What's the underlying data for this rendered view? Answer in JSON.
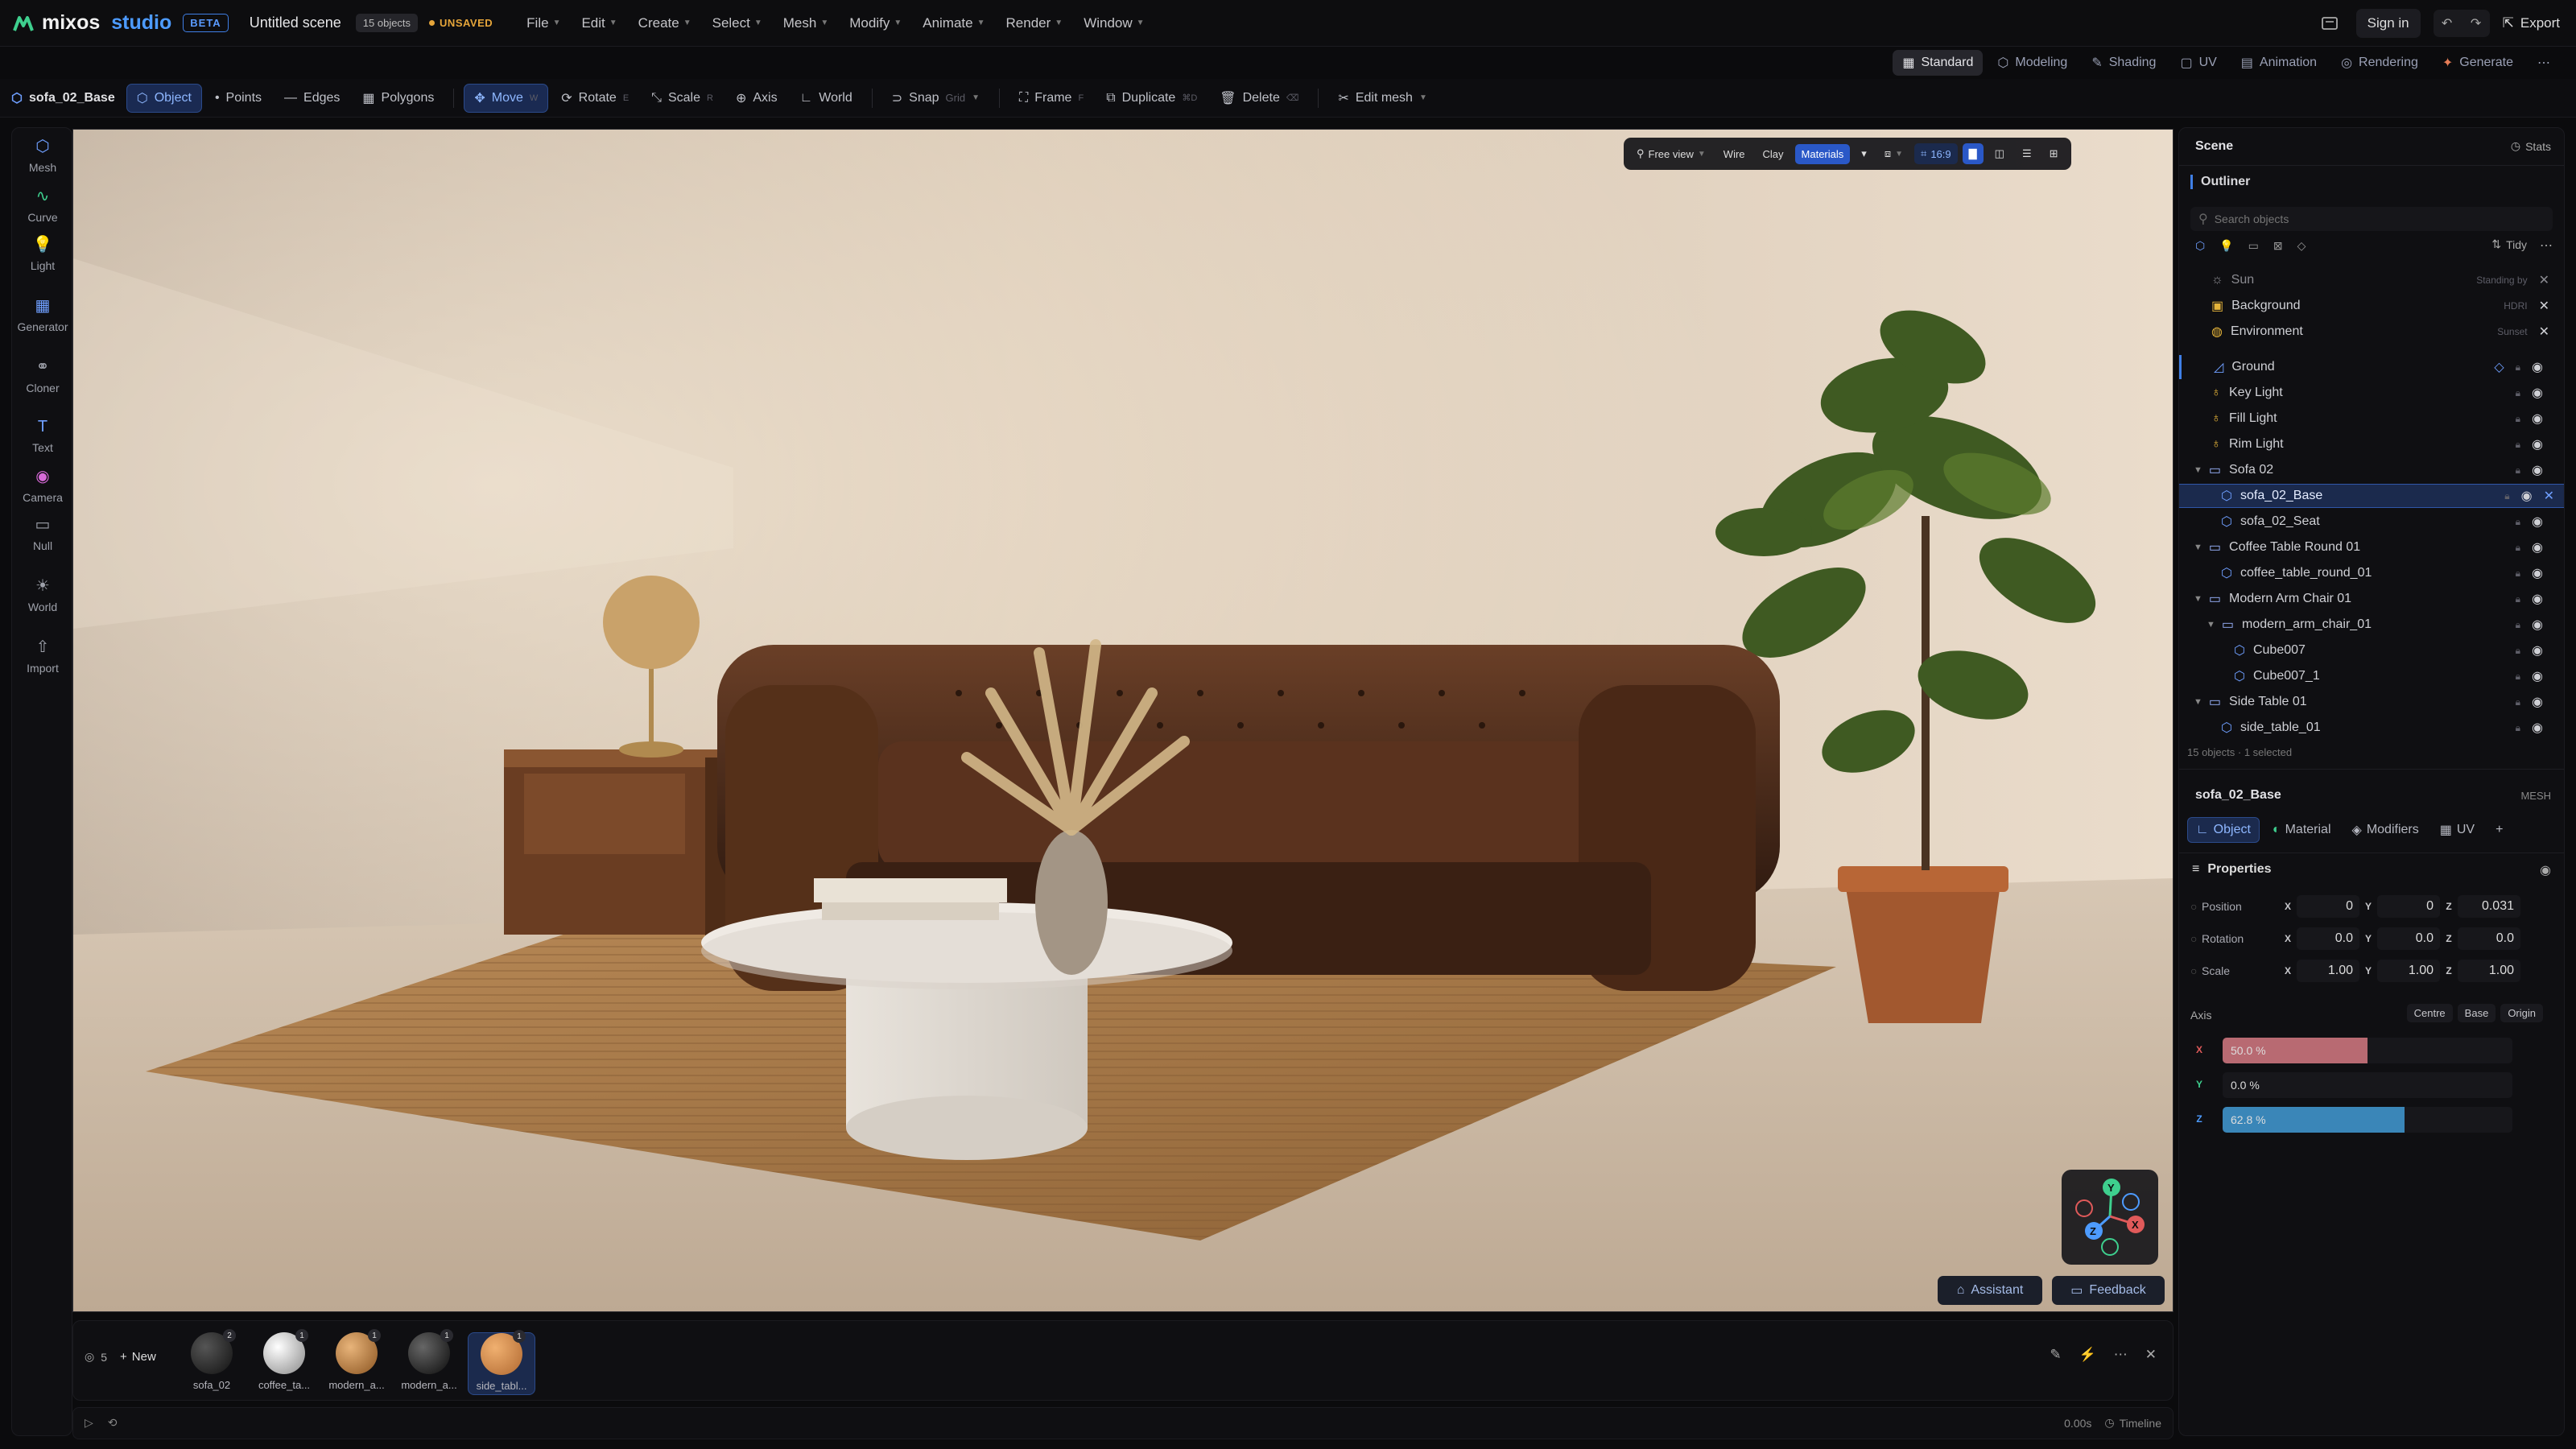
{
  "app": {
    "logo": "mixos",
    "product": "studio",
    "beta": "BETA",
    "scene_title": "Untitled scene",
    "object_count": "15 objects",
    "status": "UNSAVED",
    "menus": [
      "File",
      "Edit",
      "Create",
      "Select",
      "Mesh",
      "Modify",
      "Animate",
      "Render",
      "Window"
    ],
    "sign_in": "Sign in",
    "export": "Export"
  },
  "modes": [
    "Standard",
    "Modeling",
    "Shading",
    "UV",
    "Animation",
    "Rendering",
    "Generate"
  ],
  "toolbar": {
    "selection": "sofa_02_Base",
    "object": "Object",
    "points": "Points",
    "edges": "Edges",
    "polygons": "Polygons",
    "move": "Move",
    "move_key": "W",
    "rotate": "Rotate",
    "rotate_key": "E",
    "scale": "Scale",
    "scale_key": "R",
    "axis": "Axis",
    "world": "World",
    "snap": "Snap",
    "snap_mode": "Grid",
    "frame": "Frame",
    "frame_key": "F",
    "duplicate": "Duplicate",
    "duplicate_key": "⌘D",
    "delete": "Delete",
    "delete_key": "⌫",
    "edit_mesh": "Edit mesh"
  },
  "left_tools": [
    "Mesh",
    "Curve",
    "Light",
    "Generator",
    "Cloner",
    "Text",
    "Camera",
    "Null",
    "World",
    "Import"
  ],
  "viewport": {
    "view": "Free view",
    "wire": "Wire",
    "clay": "Clay",
    "materials": "Materials",
    "aspect": "16:9",
    "assistant": "Assistant",
    "feedback": "Feedback",
    "gizmo": {
      "y": "Y",
      "x": "X",
      "z": "Z"
    }
  },
  "assets": {
    "count": "5",
    "new": "New",
    "items": [
      {
        "label": "sofa_02",
        "badge": "2"
      },
      {
        "label": "coffee_ta...",
        "badge": "1"
      },
      {
        "label": "modern_a...",
        "badge": "1"
      },
      {
        "label": "modern_a...",
        "badge": "1"
      },
      {
        "label": "side_tabl...",
        "badge": "1"
      }
    ]
  },
  "timeline": {
    "time": "0.00s",
    "label": "Timeline"
  },
  "scene_panel": {
    "title": "Scene",
    "stats": "Stats",
    "outliner": "Outliner",
    "search_placeholder": "Search objects",
    "tidy": "Tidy",
    "env": [
      {
        "name": "Sun",
        "tag": "Standing by"
      },
      {
        "name": "Background",
        "tag": "HDRI"
      },
      {
        "name": "Environment",
        "tag": "Sunset"
      }
    ],
    "objects": [
      {
        "name": "Ground",
        "indent": 0
      },
      {
        "name": "Key Light",
        "indent": 0
      },
      {
        "name": "Fill Light",
        "indent": 0
      },
      {
        "name": "Rim Light",
        "indent": 0
      },
      {
        "name": "Sofa 02",
        "indent": 0
      },
      {
        "name": "sofa_02_Base",
        "indent": 1
      },
      {
        "name": "sofa_02_Seat",
        "indent": 1
      },
      {
        "name": "Coffee Table Round 01",
        "indent": 0
      },
      {
        "name": "coffee_table_round_01",
        "indent": 1
      },
      {
        "name": "Modern Arm Chair 01",
        "indent": 0
      },
      {
        "name": "modern_arm_chair_01",
        "indent": 1
      },
      {
        "name": "Cube007",
        "indent": 2
      },
      {
        "name": "Cube007_1",
        "indent": 2
      },
      {
        "name": "Side Table 01",
        "indent": 0
      },
      {
        "name": "side_table_01",
        "indent": 1
      }
    ],
    "footer": "15 objects · 1 selected"
  },
  "properties": {
    "object_name": "sofa_02_Base",
    "type": "MESH",
    "tabs": [
      "Object",
      "Material",
      "Modifiers",
      "UV"
    ],
    "section": "Properties",
    "position": {
      "label": "Position",
      "x": "0",
      "y": "0",
      "z": "0.031"
    },
    "rotation": {
      "label": "Rotation",
      "x": "0.0",
      "y": "0.0",
      "z": "0.0"
    },
    "scale": {
      "label": "Scale",
      "x": "1.00",
      "y": "1.00",
      "z": "1.00"
    },
    "axis": {
      "label": "Axis",
      "buttons": [
        "Centre",
        "Base",
        "Origin"
      ],
      "x": {
        "text": "50.0 %",
        "value": 0.5
      },
      "y": {
        "text": "0.0 %",
        "value": 0.0
      },
      "z": {
        "text": "62.8 %",
        "value": 0.628
      }
    }
  },
  "colors": {
    "accent": "#3f7fe6",
    "unsaved": "#e5a53a",
    "axis_x": "#b86a72",
    "axis_z": "#3a86b8"
  }
}
